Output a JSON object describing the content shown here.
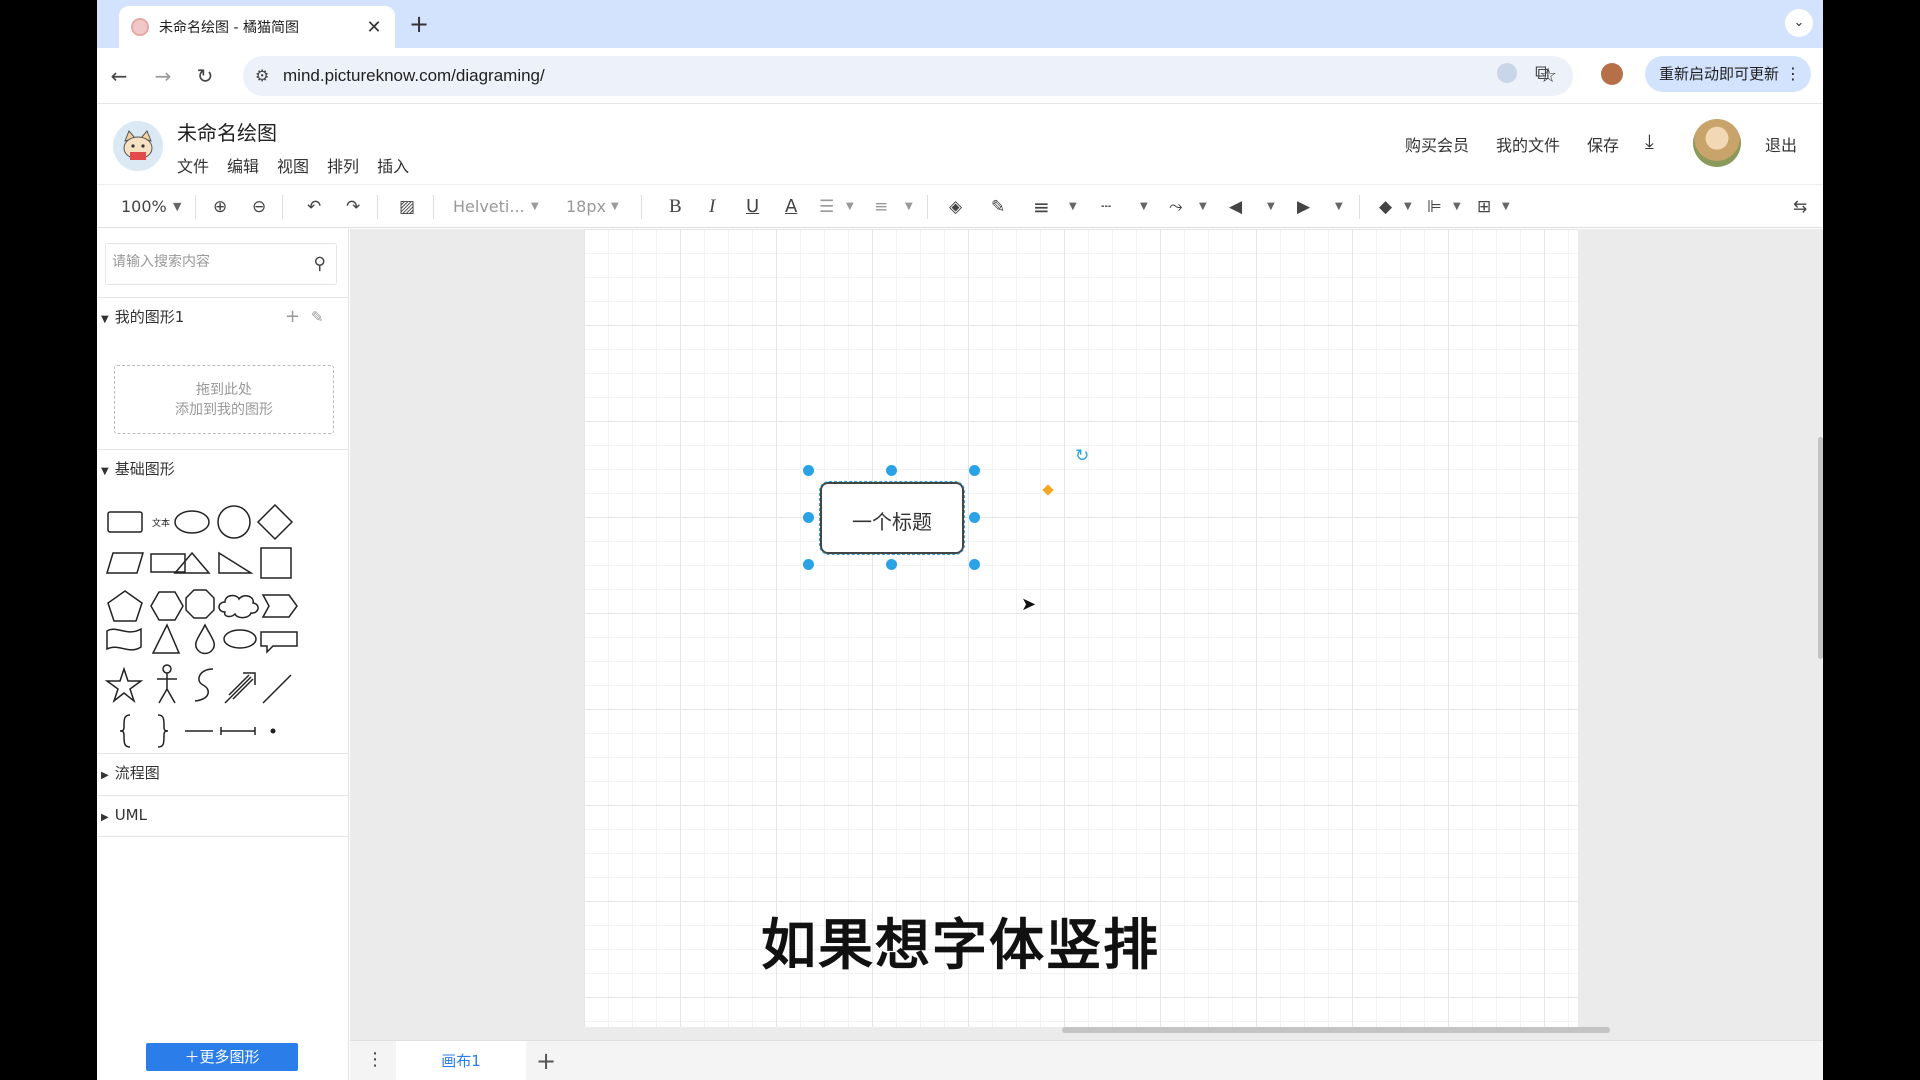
{
  "browser": {
    "tab_title": "未命名绘图 - 橘猫简图",
    "new_tab": "+",
    "close": "✕",
    "url": "mind.pictureknow.com/diagraming/",
    "update_button": "重新启动即可更新"
  },
  "app": {
    "doc_title": "未命名绘图",
    "menus": [
      "文件",
      "编辑",
      "视图",
      "排列",
      "插入"
    ],
    "header_links": {
      "buy": "购买会员",
      "my_files": "我的文件",
      "save": "保存",
      "logout": "退出"
    }
  },
  "toolbar": {
    "zoom": "100%",
    "font_family": "Helveti...",
    "font_size": "18px",
    "bold": "B",
    "italic": "I",
    "underline": "U",
    "font_color": "A"
  },
  "sidebar": {
    "search_placeholder": "请输入搜索内容",
    "my_shapes_title": "我的图形1",
    "drop_line1": "拖到此处",
    "drop_line2": "添加到我的图形",
    "basic_shapes_title": "基础图形",
    "text_shape_label": "文本",
    "flowchart_title": "流程图",
    "uml_title": "UML",
    "more_shapes": "＋更多图形"
  },
  "canvas": {
    "shape_text": "一个标题",
    "subtitle_caption": "如果想字体竖排"
  },
  "pages": {
    "current_page": "画布1"
  },
  "colors": {
    "accent": "#2b7de9",
    "selection": "#29a3e6",
    "tabbar": "#d3e3fd"
  }
}
